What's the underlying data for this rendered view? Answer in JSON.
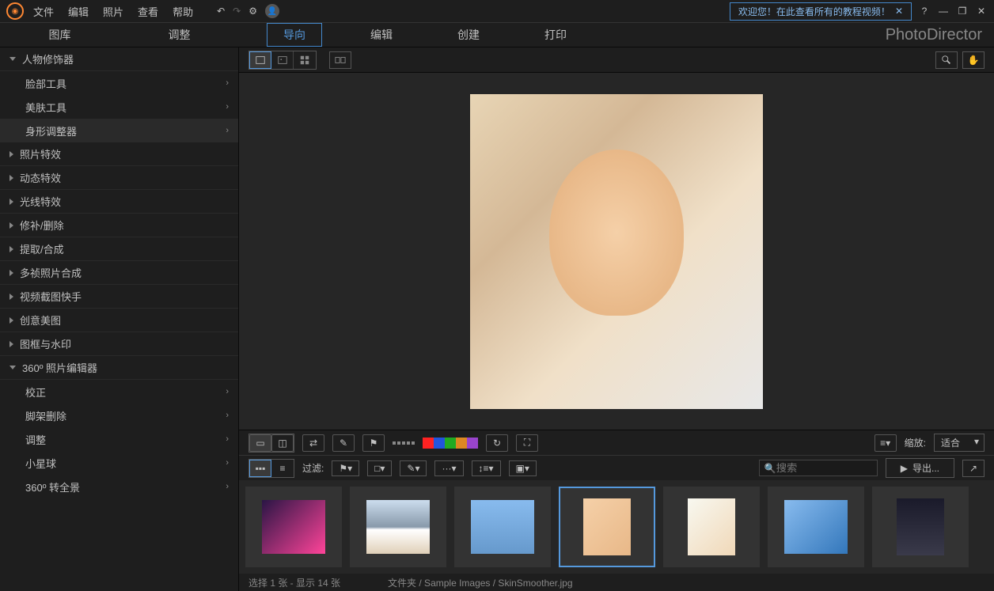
{
  "menu": {
    "items": [
      "文件",
      "编辑",
      "照片",
      "查看",
      "帮助"
    ]
  },
  "tutorial_banner": "欢迎您！在此查看所有的教程视频！",
  "left_tabs": [
    "图库",
    "调整"
  ],
  "main_tabs": [
    "导向",
    "编辑",
    "创建",
    "打印"
  ],
  "app_name": "PhotoDirector",
  "sidebar": {
    "groups": [
      {
        "label": "人物修饰器",
        "expanded": true,
        "subs": [
          "脸部工具",
          "美肤工具",
          "身形调整器"
        ]
      },
      {
        "label": "照片特效",
        "expanded": false
      },
      {
        "label": "动态特效",
        "expanded": false
      },
      {
        "label": "光线特效",
        "expanded": false
      },
      {
        "label": "修补/删除",
        "expanded": false
      },
      {
        "label": "提取/合成",
        "expanded": false
      },
      {
        "label": "多祯照片合成",
        "expanded": false
      },
      {
        "label": "视频截图快手",
        "expanded": false
      },
      {
        "label": "创意美图",
        "expanded": false
      },
      {
        "label": "图框与水印",
        "expanded": false
      },
      {
        "label": "360º 照片编辑器",
        "expanded": true,
        "subs": [
          "校正",
          "脚架删除",
          "调整",
          "小星球",
          "360º 转全景"
        ]
      }
    ]
  },
  "filter_label": "过滤:",
  "zoom_label": "缩放:",
  "zoom_value": "适合",
  "search_placeholder": "搜索",
  "export_label": "导出...",
  "swatches": [
    "#ff2222",
    "#2255dd",
    "#22aa22",
    "#dd8822",
    "#9944cc"
  ],
  "status": {
    "selection": "选择 1 张 - 显示 14 张",
    "folder_label": "文件夹",
    "path": "/ Sample Images / SkinSmoother.jpg"
  },
  "thumbs": [
    {
      "bg": "linear-gradient(135deg,#2a1545,#ff4499)"
    },
    {
      "bg": "linear-gradient(180deg,#cde,#89a 50%,#fff 55%,#e0d0b8)"
    },
    {
      "bg": "linear-gradient(180deg,#88bbee,#6699cc)"
    },
    {
      "bg": "linear-gradient(135deg,#f5d0a8,#e8b888)",
      "selected": true,
      "portrait": true
    },
    {
      "bg": "linear-gradient(135deg,#f8f8f0,#f0d8b8)",
      "portrait": true
    },
    {
      "bg": "linear-gradient(135deg,#88bbee,#3377bb)"
    },
    {
      "bg": "linear-gradient(180deg,#1a1a2a,#3a3a4a)",
      "portrait": true
    }
  ]
}
